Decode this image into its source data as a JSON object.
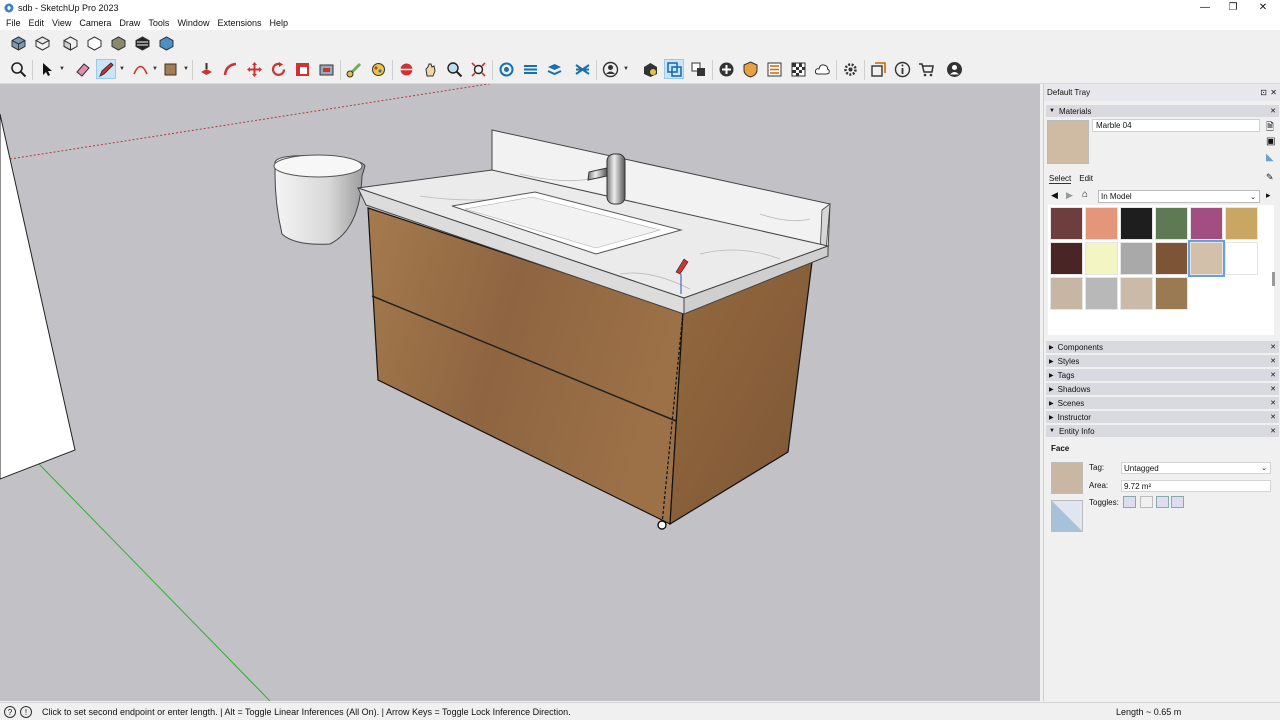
{
  "window": {
    "title": "sdb - SketchUp Pro 2023",
    "min_glyph": "—",
    "max_glyph": "❐",
    "close_glyph": "✕"
  },
  "menu": [
    "File",
    "Edit",
    "View",
    "Camera",
    "Draw",
    "Tools",
    "Window",
    "Extensions",
    "Help"
  ],
  "toolbar1": [
    "iso-view-icon",
    "top-view-icon",
    "front-view-icon",
    "right-view-icon",
    "back-view-icon",
    "left-view-icon",
    "bottom-view-icon"
  ],
  "toolbar2": [
    "zoom-window-icon",
    "select-icon",
    "eraser-icon",
    "pencil-line-icon",
    "arc-icon",
    "rectangle-icon",
    "push-pull-icon",
    "follow-me-icon",
    "move-icon",
    "rotate-icon",
    "scale-icon",
    "offset-icon",
    "tape-measure-icon",
    "paint-bucket-icon",
    "orbit-icon",
    "pan-icon",
    "zoom-icon",
    "zoom-extents-icon",
    "section-plane-icon",
    "section-cut-icon",
    "section-fill-icon",
    "display-section-icon",
    "account-icon",
    "warehouse-icon",
    "extension-icon",
    "layout-icon",
    "solid-tools-icon",
    "sandbox-icon",
    "trimble-connect-icon",
    "settings-icon",
    "dialog-icon",
    "info-icon",
    "cart-icon",
    "profile-icon"
  ],
  "tray": {
    "title": "Default Tray",
    "materials": {
      "heading": "Materials",
      "name": "Marble 04",
      "tabs": [
        "Select",
        "Edit"
      ],
      "collection": "In Model",
      "swatches": [
        "#6e3e3e",
        "#e4967a",
        "#1e1e1e",
        "#5d7a55",
        "#a34e82",
        "#c9a663",
        "#4a2526",
        "#f3f6c3",
        "#a9a9a9",
        "#7d5536",
        "#d3c0aa",
        "#ffffff",
        "#c8b6a4",
        "#b8b8b8",
        "#cbbaa7",
        "#9a7a52"
      ]
    },
    "sections": [
      "Components",
      "Styles",
      "Tags",
      "Shadows",
      "Scenes",
      "Instructor",
      "Entity Info"
    ],
    "entity_info": {
      "type": "Face",
      "tag_label": "Tag:",
      "tag_value": "Untagged",
      "area_label": "Area:",
      "area_value": "9.72 m²",
      "toggles_label": "Toggles:"
    }
  },
  "status": {
    "message": "Click to set second endpoint or enter length. | Alt = Toggle Linear Inferences (All On). | Arrow Keys = Toggle Lock Inference Direction.",
    "length_label": "Length",
    "length_value": "~ 0.65 m"
  }
}
